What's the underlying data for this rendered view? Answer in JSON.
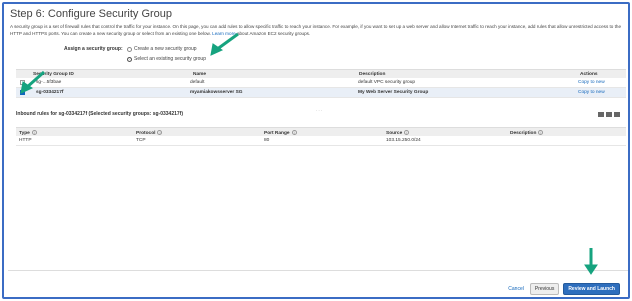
{
  "page": {
    "title": "Step 6: Configure Security Group",
    "intro_text": "A security group is a set of firewall rules that control the traffic for your instance. On this page, you can add rules to allow specific traffic to reach your instance. For example, if you want to set up a web server and allow Internet traffic to reach your instance, add rules that allow unrestricted access to the HTTP and HTTPS ports. You can create a new security group or select from an existing one below.",
    "intro_link": "Learn more",
    "intro_tail": "about Amazon EC2 security groups."
  },
  "assign": {
    "label": "Assign a security group:",
    "options": [
      {
        "label": "Create a new security group",
        "selected": false
      },
      {
        "label": "Select an existing security group",
        "selected": true
      }
    ]
  },
  "security_groups": {
    "columns": [
      "Security Group ID",
      "Name",
      "Description",
      "Actions"
    ],
    "rows": [
      {
        "id": "sg-...5f3bae",
        "name": "default",
        "description": "default VPC security group",
        "action": "Copy to new",
        "checked": false
      },
      {
        "id": "sg-0334217f",
        "name": "myamiakowsserver SG",
        "description": "My Web Server Security Group",
        "action": "Copy to new",
        "checked": true
      }
    ]
  },
  "inbound": {
    "title": "Inbound rules for sg-0334217f (Selected security groups: sg-0334217f)",
    "columns": [
      "Type",
      "Protocol",
      "Port Range",
      "Source",
      "Description"
    ],
    "rows": [
      {
        "type": "HTTP",
        "protocol": "TCP",
        "port": "80",
        "source": "103.15.250.0/24",
        "description": ""
      }
    ]
  },
  "footer": {
    "cancel": "Cancel",
    "previous": "Previous",
    "review": "Review and Launch"
  },
  "colors": {
    "annotation_arrow": "#16a37f",
    "link": "#1166bb",
    "primary_button": "#2e6ebd",
    "frame_border": "#3b6cc4"
  },
  "icons": {
    "annotation": "arrow-icon",
    "info": "info-icon",
    "view_toggle": "layout-icon"
  }
}
